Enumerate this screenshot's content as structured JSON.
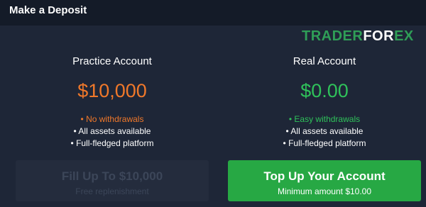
{
  "header": {
    "title": "Make a Deposit"
  },
  "watermark": {
    "part1": "TRADER",
    "part2": "FOR",
    "part3": "EX"
  },
  "practice": {
    "title": "Practice Account",
    "amount": "$10,000",
    "features": [
      "• No withdrawals",
      "• All assets available",
      "• Full-fledged platform"
    ],
    "button_label": "Fill Up To $10,000",
    "button_sub": "Free replenishment"
  },
  "real": {
    "title": "Real Account",
    "amount": "$0.00",
    "features": [
      "• Easy withdrawals",
      "• All assets available",
      "• Full-fledged platform"
    ],
    "button_label": "Top Up Your Account",
    "button_sub": "Minimum amount  $10.00"
  },
  "colors": {
    "accent_orange": "#f0782a",
    "accent_green": "#2fc15a",
    "button_green": "#27a844",
    "background": "#1e2637"
  }
}
